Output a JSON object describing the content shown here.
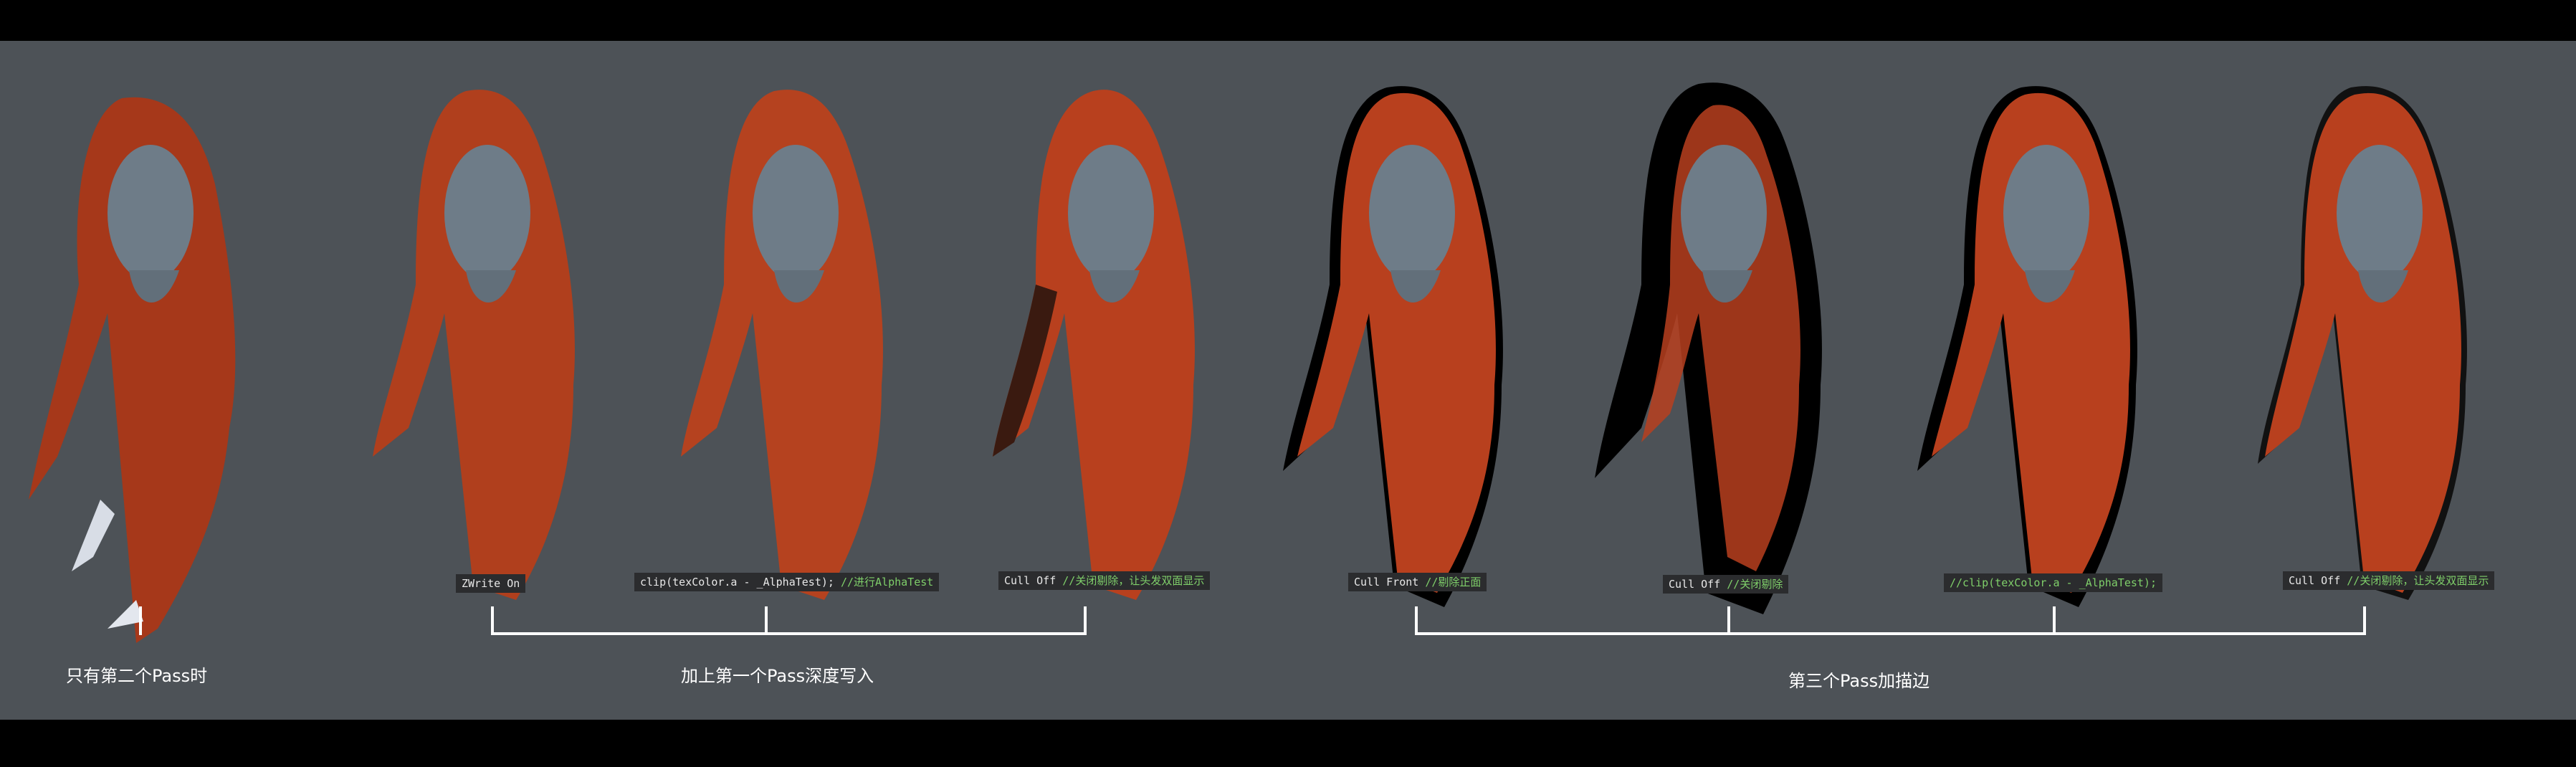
{
  "labels": [
    {
      "code": "ZWrite On",
      "comment": ""
    },
    {
      "code": "clip(texColor.a - _AlphaTest);",
      "comment": " //进行AlphaTest"
    },
    {
      "code": "Cull Off",
      "comment": " //关闭剔除，让头发双面显示"
    },
    {
      "code": "Cull Front",
      "comment": " //剔除正面"
    },
    {
      "code": "Cull Off",
      "comment": " //关闭剔除"
    },
    {
      "code": "",
      "comment": "//clip(texColor.a - _AlphaTest);"
    },
    {
      "code": "Cull Off",
      "comment": " //关闭剔除，让头发双面显示"
    }
  ],
  "captions": {
    "group1": "只有第二个Pass时",
    "group2": "加上第一个Pass深度写入",
    "group3": "第三个Pass加描边"
  },
  "colors": {
    "background": "#4d5257",
    "hair": "#b8401e",
    "head": "#6e7c88",
    "outline": "#000000",
    "comment": "#7fcf6a"
  }
}
